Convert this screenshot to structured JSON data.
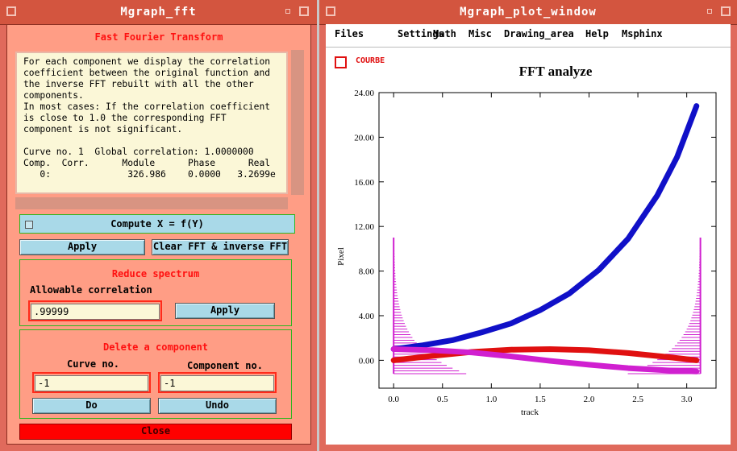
{
  "fft_window": {
    "title": "Mgraph_fft",
    "heading": "Fast Fourier Transform",
    "info_text": "For each component we display the correlation\ncoefficient between the original function and\nthe inverse FFT rebuilt with all the other\ncomponents.\nIn most cases: If the correlation coefficient\nis close to 1.0 the corresponding FFT\ncomponent is not significant.\n\nCurve no. 1  Global correlation: 1.0000000\nComp.  Corr.      Module      Phase      Real\n   0:              326.986    0.0000   3.2699e",
    "compute_label": "Compute X = f(Y)",
    "apply_label": "Apply",
    "clear_label": "Clear FFT & inverse FFT",
    "reduce_heading": "Reduce spectrum",
    "allowable_label": "Allowable correlation",
    "correlation_value": ".99999",
    "reduce_apply_label": "Apply",
    "delete_heading": "Delete a component",
    "curve_label": "Curve no.",
    "component_label": "Component no.",
    "curve_value": "-1",
    "component_value": "-1",
    "do_label": "Do",
    "undo_label": "Undo",
    "close_label": "Close"
  },
  "plot_window": {
    "title": "Mgraph_plot_window",
    "menu": [
      "Files",
      "Settings",
      "Math",
      "Misc",
      "Drawing_area",
      "Help",
      "Msphinx"
    ],
    "legend_label": "COURBE"
  },
  "chart_data": {
    "type": "scatter",
    "title": "FFT analyze",
    "xlabel": "track",
    "ylabel": "Pixel",
    "xlim": [
      -0.15,
      3.3
    ],
    "ylim": [
      -2.5,
      24
    ],
    "xticks": [
      "0.0",
      "0.5",
      "1.0",
      "1.5",
      "2.0",
      "2.5",
      "3.0"
    ],
    "yticks": [
      "0.00",
      "4.00",
      "8.00",
      "12.00",
      "16.00",
      "20.00",
      "24.00"
    ],
    "series": [
      {
        "color": "#1010c8",
        "x": [
          0.0,
          0.3,
          0.6,
          0.9,
          1.2,
          1.5,
          1.8,
          2.1,
          2.4,
          2.7,
          2.9,
          3.1
        ],
        "y": [
          1.0,
          1.35,
          1.8,
          2.5,
          3.3,
          4.5,
          6.0,
          8.1,
          10.9,
          14.8,
          18.2,
          22.8
        ]
      },
      {
        "color": "#e01010",
        "x": [
          0.0,
          0.4,
          0.8,
          1.2,
          1.6,
          2.0,
          2.4,
          2.8,
          3.1
        ],
        "y": [
          0.0,
          0.4,
          0.75,
          0.95,
          1.0,
          0.9,
          0.65,
          0.3,
          0.0
        ]
      },
      {
        "color": "#d020d0",
        "x": [
          0.0,
          0.4,
          0.8,
          1.2,
          1.6,
          2.0,
          2.4,
          2.8,
          3.1
        ],
        "y": [
          1.0,
          0.9,
          0.7,
          0.35,
          -0.05,
          -0.4,
          -0.7,
          -0.9,
          -1.0
        ]
      }
    ],
    "spectrum_color": "#d020d0",
    "grid": false
  }
}
